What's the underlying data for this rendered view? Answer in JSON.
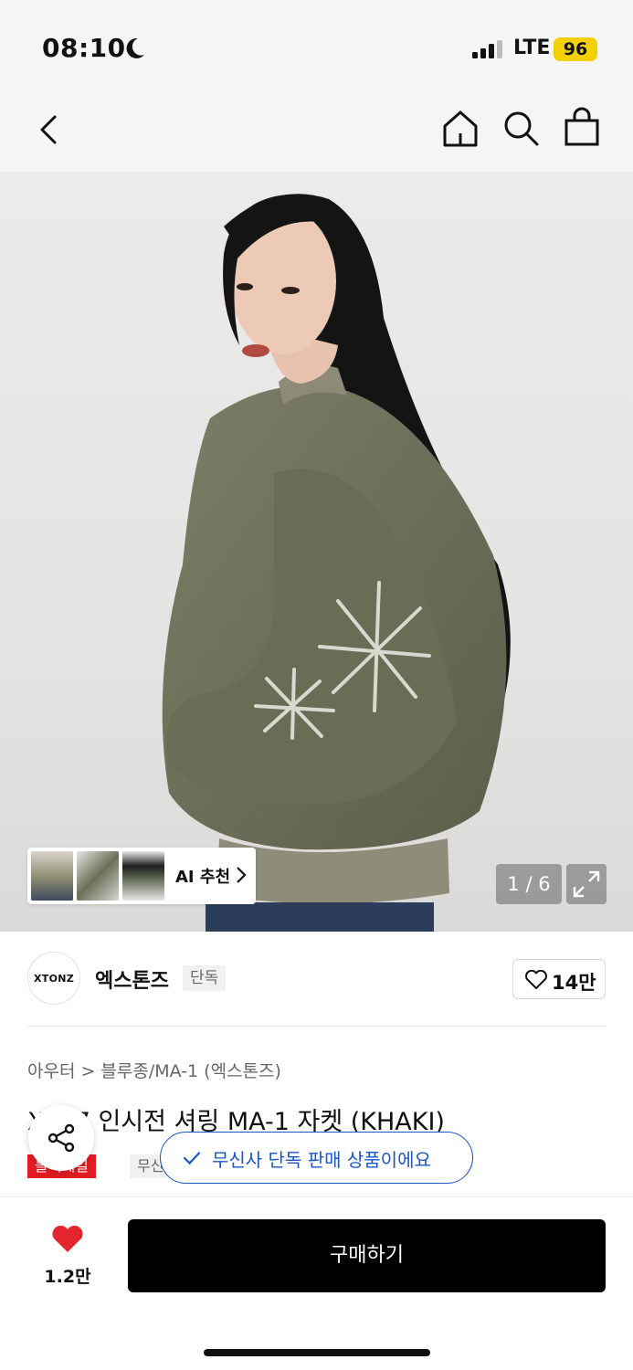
{
  "status_bar": {
    "time": "08:10",
    "network": "LTE",
    "battery": "96"
  },
  "header": {
    "icons": [
      "back-icon",
      "home-icon",
      "search-icon",
      "bag-icon"
    ]
  },
  "gallery": {
    "ai_recommend_label": "AI 추천",
    "page_indicator": "1 / 6",
    "current_page": 1,
    "total_pages": 6
  },
  "brand": {
    "logo_text": "XTONZ",
    "name": "엑스톤즈",
    "tag": "단독",
    "like_count": "14만"
  },
  "product": {
    "breadcrumb": [
      "아우터",
      "블루종/MA-1 (엑스톤즈)"
    ],
    "breadcrumb_sep": ">",
    "title": "XT07 인시전 셔링 MA-1 자켓 (KHAKI)",
    "badges": [
      "블랙세일",
      "무신사단독"
    ]
  },
  "toast": {
    "text": "무신사 단독 판매 상품이에요"
  },
  "bottom_bar": {
    "wish_count": "1.2만",
    "buy_label": "구매하기"
  },
  "colors": {
    "accent_blue": "#1a56c8",
    "sale_red": "#e31b23",
    "battery_yellow": "#f5d000",
    "heart_red": "#e3262d"
  }
}
